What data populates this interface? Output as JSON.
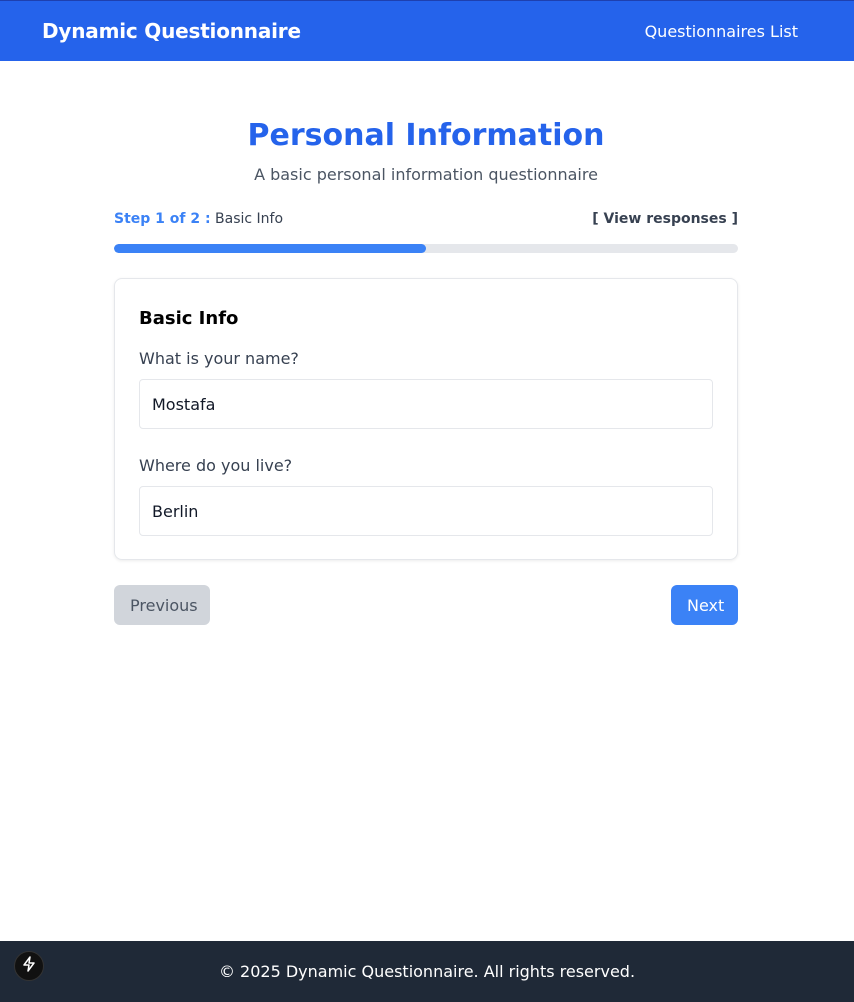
{
  "header": {
    "brand": "Dynamic Questionnaire",
    "nav_link": "Questionnaires List"
  },
  "questionnaire": {
    "title": "Personal Information",
    "description": "A basic personal information questionnaire"
  },
  "step": {
    "label": "Step 1 of 2 :",
    "name": "Basic Info",
    "view_responses": "[ View responses ]",
    "progress_fraction": 0.5
  },
  "section": {
    "title": "Basic Info",
    "questions": [
      {
        "label": "What is your name?",
        "value": "Mostafa"
      },
      {
        "label": "Where do you live?",
        "value": "Berlin"
      }
    ]
  },
  "buttons": {
    "previous": "Previous",
    "next": "Next"
  },
  "footer": {
    "text": "© 2025 Dynamic Questionnaire. All rights reserved."
  },
  "colors": {
    "primary": "#2563eb",
    "accent": "#3b82f6",
    "footer_bg": "#1f2937"
  },
  "icons": {
    "dev_badge": "lightning-bolt-icon"
  }
}
